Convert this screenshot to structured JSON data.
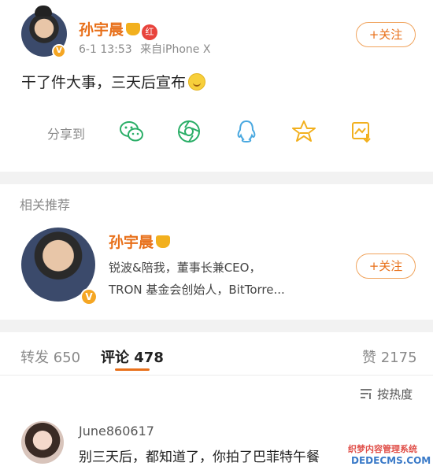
{
  "post": {
    "username": "孙宇晨",
    "red_badge": "红",
    "timestamp": "6-1 13:53",
    "source": "来自iPhone X",
    "follow_label": "+关注",
    "text": "干了件大事，三天后宣布"
  },
  "share": {
    "label": "分享到",
    "icons": [
      "wechat-icon",
      "moments-icon",
      "qq-icon",
      "qzone-icon",
      "save-image-icon"
    ]
  },
  "related": {
    "title": "相关推荐",
    "name": "孙宇晨",
    "desc_line1": "锐波&陪我，董事长兼CEO，",
    "desc_line2": "TRON 基金会创始人，BitTorre...",
    "follow_label": "+关注"
  },
  "tabs": {
    "repost": "转发 650",
    "comment": "评论 478",
    "like": "赞 2175"
  },
  "sort": {
    "label": "按热度"
  },
  "comment": {
    "username": "June860617",
    "text": "别三天后，都知道了，你拍了巴菲特午餐"
  },
  "watermark": {
    "line1": "织梦内容管理系统",
    "line2": "DEDECMS.COM"
  },
  "colors": {
    "accent": "#e8701a",
    "share_icon": "#2aae67",
    "divider": "#f2f2f2"
  }
}
